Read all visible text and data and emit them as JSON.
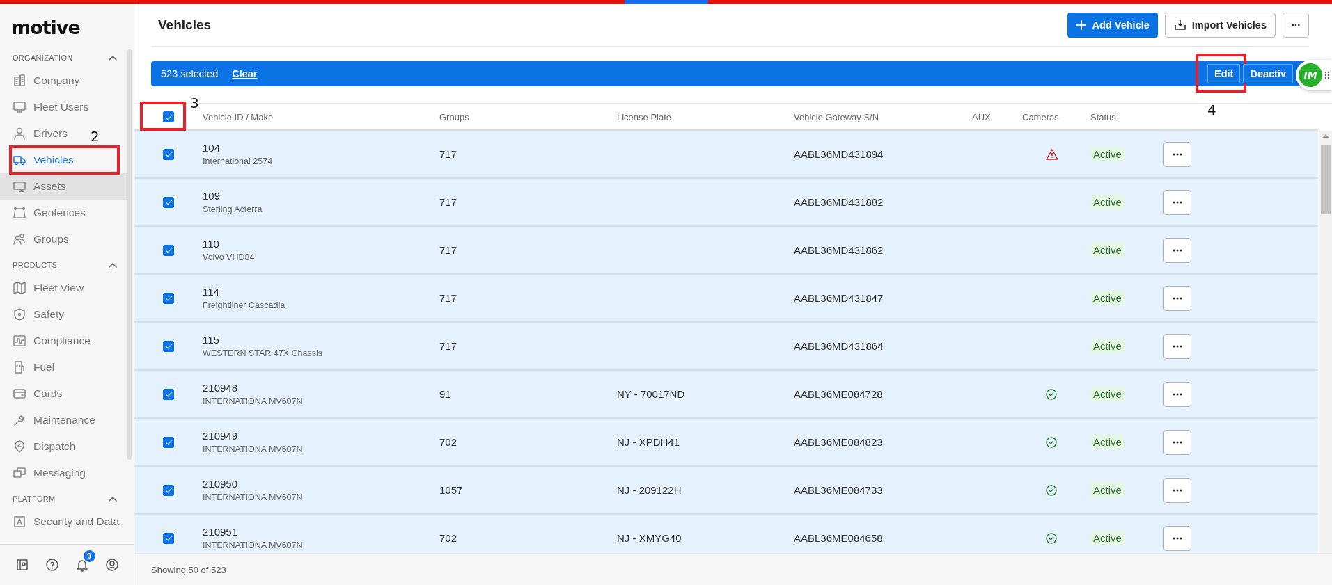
{
  "logo": "motive",
  "sidebar": {
    "sections": [
      {
        "title": "ORGANIZATION",
        "expanded": true,
        "items": [
          {
            "label": "Company",
            "selected": false,
            "hovered": false
          },
          {
            "label": "Fleet Users",
            "selected": false,
            "hovered": false
          },
          {
            "label": "Drivers",
            "selected": false,
            "hovered": false
          },
          {
            "label": "Vehicles",
            "selected": true,
            "hovered": false,
            "callout": "2"
          },
          {
            "label": "Assets",
            "selected": false,
            "hovered": true
          },
          {
            "label": "Geofences",
            "selected": false,
            "hovered": false
          },
          {
            "label": "Groups",
            "selected": false,
            "hovered": false
          }
        ]
      },
      {
        "title": "PRODUCTS",
        "expanded": true,
        "items": [
          {
            "label": "Fleet View",
            "selected": false,
            "hovered": false
          },
          {
            "label": "Safety",
            "selected": false,
            "hovered": false
          },
          {
            "label": "Compliance",
            "selected": false,
            "hovered": false
          },
          {
            "label": "Fuel",
            "selected": false,
            "hovered": false
          },
          {
            "label": "Cards",
            "selected": false,
            "hovered": false
          },
          {
            "label": "Maintenance",
            "selected": false,
            "hovered": false
          },
          {
            "label": "Dispatch",
            "selected": false,
            "hovered": false
          },
          {
            "label": "Messaging",
            "selected": false,
            "hovered": false
          }
        ]
      },
      {
        "title": "PLATFORM",
        "expanded": true,
        "items": [
          {
            "label": "Security and Data",
            "selected": false,
            "hovered": false
          }
        ]
      }
    ],
    "notification_badge": "9"
  },
  "header": {
    "title": "Vehicles",
    "buttons": [
      {
        "label": "Add Vehicle",
        "kind": "primary"
      },
      {
        "label": "Import Vehicles",
        "kind": "import"
      },
      {
        "kind": "more"
      }
    ]
  },
  "selection_bar": {
    "count": "523 selected",
    "clear": "Clear",
    "actions": [
      {
        "label": "Edit",
        "callout": "4"
      },
      {
        "label": "Deactiv"
      }
    ]
  },
  "avatar": {
    "initials": "IM"
  },
  "table": {
    "select_all": {
      "checked": true,
      "callout": "3"
    },
    "columns": [
      "Vehicle ID / Make",
      "Groups",
      "License Plate",
      "Vehicle Gateway S/N",
      "AUX",
      "Cameras",
      "Status"
    ],
    "rows": [
      {
        "selected": true,
        "id": "104",
        "make": "International 2574",
        "groups": "717",
        "gateway": "AABL36MD431894",
        "camera": {
          "kind": "warning"
        },
        "status": "Active"
      },
      {
        "selected": true,
        "id": "109",
        "make": "Sterling Acterra",
        "groups": "717",
        "gateway": "AABL36MD431882",
        "status": "Active"
      },
      {
        "selected": true,
        "id": "110",
        "make": "Volvo VHD84",
        "groups": "717",
        "gateway": "AABL36MD431862",
        "status": "Active"
      },
      {
        "selected": true,
        "id": "114",
        "make": "Freightliner Cascadia",
        "groups": "717",
        "gateway": "AABL36MD431847",
        "status": "Active"
      },
      {
        "selected": true,
        "id": "115",
        "make": "WESTERN STAR 47X Chassis",
        "groups": "717",
        "gateway": "AABL36MD431864",
        "status": "Active"
      },
      {
        "selected": true,
        "id": "210948",
        "make": "INTERNATIONA MV607N",
        "groups": "91",
        "plate": "NY - 70017ND",
        "gateway": "AABL36ME084728",
        "camera": {
          "kind": "ok"
        },
        "status": "Active"
      },
      {
        "selected": true,
        "id": "210949",
        "make": "INTERNATIONA MV607N",
        "groups": "702",
        "plate": "NJ - XPDH41",
        "gateway": "AABL36ME084823",
        "camera": {
          "kind": "ok"
        },
        "status": "Active"
      },
      {
        "selected": true,
        "id": "210950",
        "make": "INTERNATIONA MV607N",
        "groups": "1057",
        "plate": "NJ - 209122H",
        "gateway": "AABL36ME084733",
        "camera": {
          "kind": "ok"
        },
        "status": "Active"
      },
      {
        "selected": true,
        "id": "210951",
        "make": "INTERNATIONA MV607N",
        "groups": "702",
        "plate": "NJ - XMYG40",
        "gateway": "AABL36ME084658",
        "camera": {
          "kind": "ok"
        },
        "status": "Active"
      }
    ]
  },
  "footer": "Showing 50 of 523"
}
